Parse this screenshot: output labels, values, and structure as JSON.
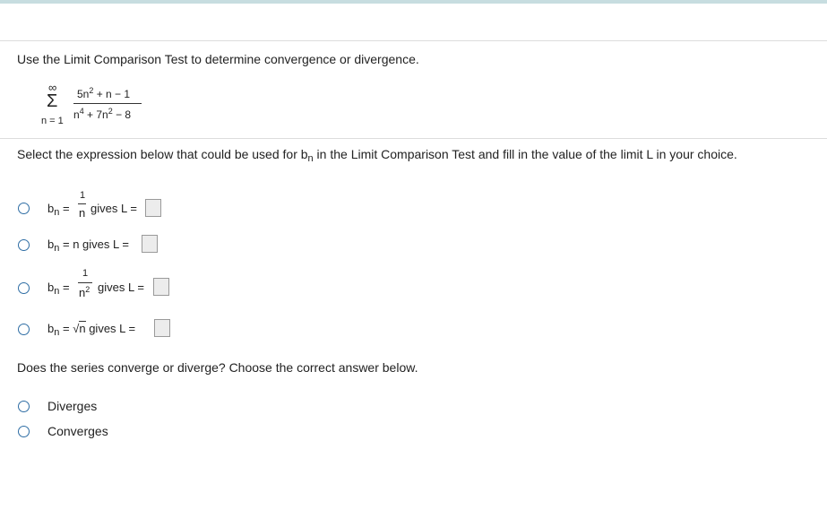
{
  "question": {
    "instruction": "Use the Limit Comparison Test to determine convergence or divergence.",
    "series": {
      "sigma": "Σ",
      "upper": "∞",
      "lower": "n = 1",
      "numerator": "5n",
      "numerator_exp": "2",
      "numerator_rest": " + n − 1",
      "denominator_a": "n",
      "denominator_a_exp": "4",
      "denominator_b": " + 7n",
      "denominator_b_exp": "2",
      "denominator_c": " − 8"
    },
    "select_prompt_a": "Select the expression below that could be used for b",
    "select_prompt_sub": "n",
    "select_prompt_b": " in the Limit Comparison Test and fill in the value of the limit L in your choice."
  },
  "options": {
    "b": "b",
    "sub": "n",
    "eq": "=",
    "gives": "gives L =",
    "one": "1",
    "n": "n",
    "n2_base": "n",
    "n2_exp": "2",
    "opt2_expr": "= n gives L =",
    "sqrt": "√",
    "sqrt_n": "n"
  },
  "second_question": {
    "prompt": "Does the series converge or diverge? Choose the correct answer below.",
    "answers": [
      "Diverges",
      "Converges"
    ]
  }
}
